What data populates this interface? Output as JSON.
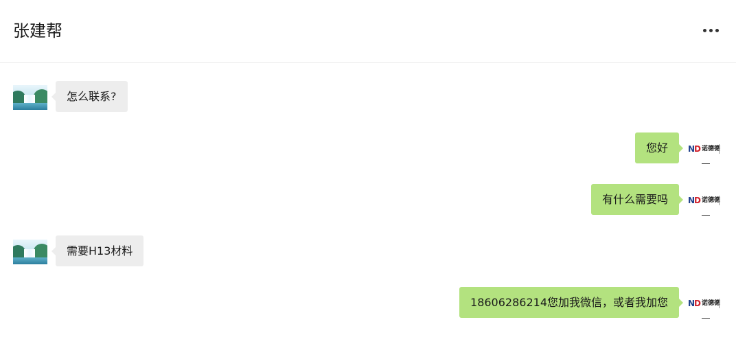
{
  "header": {
    "title": "张建帮",
    "more_icon": "more-horizontal-icon"
  },
  "messages": [
    {
      "side": "left",
      "avatar": "landscape-waterfall-avatar",
      "text": "怎么联系?"
    },
    {
      "side": "right",
      "avatar": "brand-logo-avatar",
      "text": "您好"
    },
    {
      "side": "right",
      "avatar": "brand-logo-avatar",
      "text": "有什么需要吗"
    },
    {
      "side": "left",
      "avatar": "landscape-waterfall-avatar",
      "text": "需要H13材料"
    },
    {
      "side": "right",
      "avatar": "brand-logo-avatar",
      "text": "18606286214您加我微信，或者我加您"
    }
  ],
  "logo": {
    "mark_n": "N",
    "mark_d": "D",
    "cn": "诺德德"
  },
  "colors": {
    "incoming_bubble": "#ededed",
    "outgoing_bubble": "#b3e27f",
    "text": "#1a1a1a",
    "divider": "#e9e9e9"
  }
}
